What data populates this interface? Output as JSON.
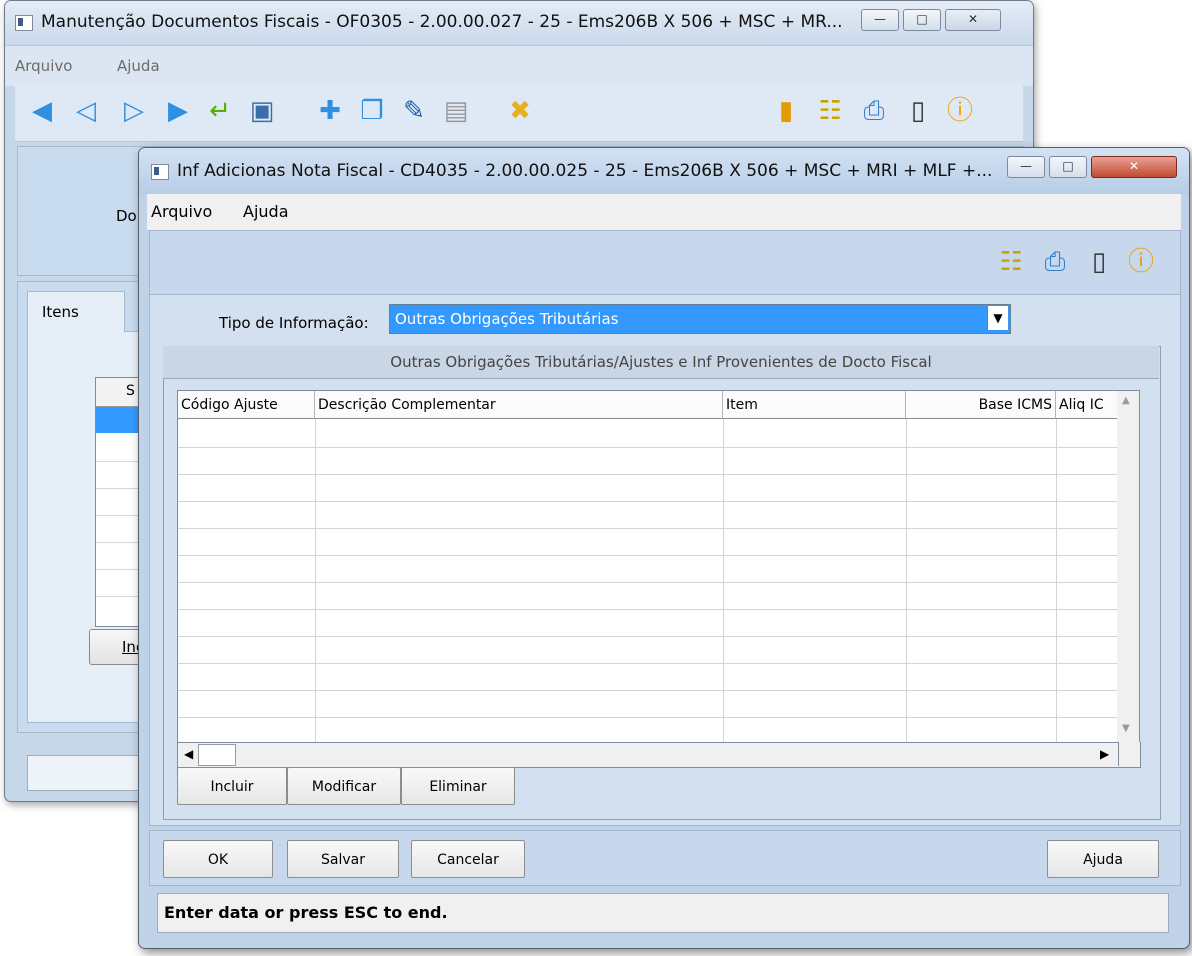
{
  "back_window": {
    "title": "Manutenção Documentos Fiscais - OF0305 - 2.00.00.027 - 25 - Ems206B X 506 + MSC + MR...",
    "menu": [
      "Arquivo",
      "Ajuda"
    ],
    "doc_label_fragment": "Do",
    "tab_label": "Itens",
    "grid_header_fragment": "S",
    "include_button_fragment": "Inc",
    "toolbar_icons": [
      "first-record-icon",
      "prev-record-icon",
      "next-record-icon",
      "last-record-icon",
      "goto-icon",
      "search-icon",
      "new-record-icon",
      "copy-record-icon",
      "edit-record-icon",
      "delete-record-icon",
      "cancel-record-icon",
      "book-icon",
      "tree-icon",
      "print-icon",
      "exit-icon",
      "help-icon"
    ]
  },
  "front_window": {
    "title": "Inf Adicionas Nota Fiscal - CD4035 - 2.00.00.025 - 25 - Ems206B X 506 + MSC + MRI + MLF +...",
    "menu": [
      "Arquivo",
      "Ajuda"
    ],
    "tipo_label": "Tipo de Informação:",
    "tipo_value": "Outras Obrigações Tributárias",
    "group_title": "Outras Obrigações Tributárias/Ajustes e Inf Provenientes de Docto Fiscal",
    "columns": [
      "Código Ajuste",
      "Descrição Complementar",
      "Item",
      "Base ICMS",
      "Aliq IC"
    ],
    "grid_buttons": [
      "Incluir",
      "Modificar",
      "Eliminar"
    ],
    "footer_buttons": {
      "ok": "OK",
      "salvar": "Salvar",
      "cancelar": "Cancelar",
      "ajuda": "Ajuda"
    },
    "status": "Enter data or press ESC to end."
  },
  "colors": {
    "selection": "#3399ff",
    "window_bg": "#bfd2e7"
  }
}
